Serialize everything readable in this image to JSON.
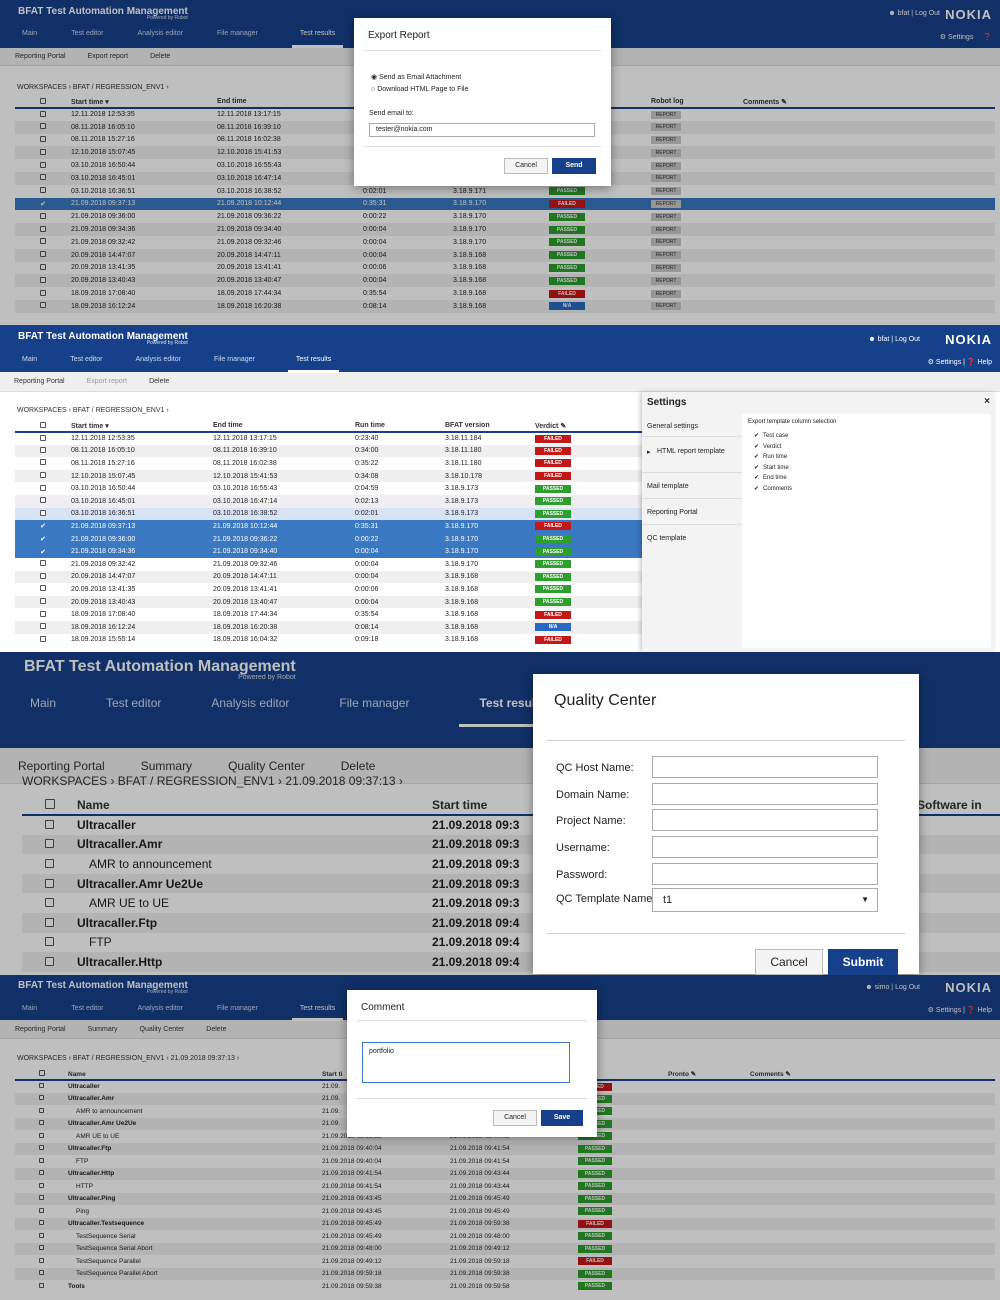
{
  "colors": {
    "brand": "#16418a",
    "passed": "#2e9e2e",
    "failed": "#c31818",
    "na": "#2a68c2",
    "selected": "#3a78c2"
  },
  "p1": {
    "app_title": "BFAT Test Automation Management",
    "powered": "Powered by Robot",
    "user": "bfat",
    "logout": "Log Out",
    "nokia": "NOKIA",
    "settings": "Settings",
    "nav": [
      "Main",
      "Test editor",
      "Analysis editor",
      "File manager",
      "Test results"
    ],
    "sub": [
      "Reporting Portal",
      "Export report",
      "Delete"
    ],
    "crumb": "WORKSPACES › BFAT / REGRESSION_ENV1 ›",
    "cols": [
      "Start time ▾",
      "End time",
      "Robot log",
      "Comments"
    ],
    "rows": [
      {
        "s": "12.11.2018 12:53:35",
        "e": "12.11.2018 13:17:15",
        "r": "",
        "v": "",
        "vc": ""
      },
      {
        "s": "08.11.2018 16:05:10",
        "e": "08.11.2018 16:39:10",
        "r": "",
        "v": "",
        "vc": ""
      },
      {
        "s": "08.11.2018 15:27:16",
        "e": "08.11.2018 16:02:38",
        "r": "",
        "v": "",
        "vc": ""
      },
      {
        "s": "12.10.2018 15:07:45",
        "e": "12.10.2018 15:41:53",
        "r": "",
        "v": "",
        "vc": ""
      },
      {
        "s": "03.10.2018 16:50:44",
        "e": "03.10.2018 16:55:43",
        "r": "",
        "v": "",
        "vc": ""
      },
      {
        "s": "03.10.2018 16:45:01",
        "e": "03.10.2018 16:47:14",
        "r": "",
        "v": "",
        "vc": ""
      },
      {
        "s": "03.10.2018 16:36:51",
        "e": "03.10.2018 16:38:52",
        "r": "0:02:01",
        "b": "3.18.9.171",
        "v": "PASSED",
        "vc": "passed"
      },
      {
        "s": "21.09.2018 09:37:13",
        "e": "21.09.2018 10:12:44",
        "r": "0:35:31",
        "b": "3.18.9.170",
        "v": "FAILED",
        "vc": "failed",
        "sel": true
      },
      {
        "s": "21.09.2018 09:36:00",
        "e": "21.09.2018 09:36:22",
        "r": "0:00:22",
        "b": "3.18.9.170",
        "v": "PASSED",
        "vc": "passed"
      },
      {
        "s": "21.09.2018 09:34:36",
        "e": "21.09.2018 09:34:40",
        "r": "0:00:04",
        "b": "3.18.9.170",
        "v": "PASSED",
        "vc": "passed"
      },
      {
        "s": "21.09.2018 09:32:42",
        "e": "21.09.2018 09:32:46",
        "r": "0:00:04",
        "b": "3.18.9.170",
        "v": "PASSED",
        "vc": "passed"
      },
      {
        "s": "20.09.2018 14:47:07",
        "e": "20.09.2018 14:47:11",
        "r": "0:00:04",
        "b": "3.18.9.168",
        "v": "PASSED",
        "vc": "passed"
      },
      {
        "s": "20.09.2018 13:41:35",
        "e": "20.09.2018 13:41:41",
        "r": "0:00:06",
        "b": "3.18.9.168",
        "v": "PASSED",
        "vc": "passed"
      },
      {
        "s": "20.09.2018 13:40:43",
        "e": "20.09.2018 13:40:47",
        "r": "0:00:04",
        "b": "3.18.9.168",
        "v": "PASSED",
        "vc": "passed"
      },
      {
        "s": "18.09.2018 17:08:40",
        "e": "18.09.2018 17:44:34",
        "r": "0:35:54",
        "b": "3.18.9.168",
        "v": "FAILED",
        "vc": "failed"
      },
      {
        "s": "18.09.2018 16:12:24",
        "e": "18.09.2018 16:20:38",
        "r": "0:08:14",
        "b": "3.18.9.168",
        "v": "N/A",
        "vc": "na"
      }
    ],
    "report": "REPORT",
    "modal": {
      "title": "Export Report",
      "opt1": "Send as Email Attachment",
      "opt2": "Download HTML Page to File",
      "email_label": "Send email to:",
      "email_value": "tester@nokia.com",
      "cancel": "Cancel",
      "send": "Send"
    }
  },
  "p2": {
    "app_title": "BFAT Test Automation Management",
    "powered": "Powered by Robot",
    "user": "bfat",
    "logout": "Log Out",
    "nokia": "NOKIA",
    "settings": "Settings",
    "help": "Help",
    "nav": [
      "Main",
      "Test editor",
      "Analysis editor",
      "File manager",
      "Test results"
    ],
    "sub": [
      "Reporting Portal",
      "Export report",
      "Delete"
    ],
    "crumb": "WORKSPACES › BFAT / REGRESSION_ENV1 ›",
    "cols": [
      "Start time ▾",
      "End time",
      "Run time",
      "BFAT version",
      "Verdict"
    ],
    "rows": [
      {
        "s": "12.11.2018 12:53:35",
        "e": "12.11.2018 13:17:15",
        "r": "0:23:40",
        "b": "3.18.11.184",
        "v": "FAILED",
        "vc": "failed"
      },
      {
        "s": "08.11.2018 16:05:10",
        "e": "08.11.2018 16:39:10",
        "r": "0:34:00",
        "b": "3.18.11.180",
        "v": "FAILED",
        "vc": "failed"
      },
      {
        "s": "08.11.2018 15:27:16",
        "e": "08.11.2018 16:02:38",
        "r": "0:35:22",
        "b": "3.18.11.180",
        "v": "FAILED",
        "vc": "failed"
      },
      {
        "s": "12.10.2018 15:07:45",
        "e": "12.10.2018 15:41:53",
        "r": "0:34:08",
        "b": "3.18.10.178",
        "v": "FAILED",
        "vc": "failed"
      },
      {
        "s": "03.10.2018 16:50:44",
        "e": "03.10.2018 16:55:43",
        "r": "0:04:59",
        "b": "3.18.9.173",
        "v": "PASSED",
        "vc": "passed"
      },
      {
        "s": "03.10.2018 16:45:01",
        "e": "03.10.2018 16:47:14",
        "r": "0:02:13",
        "b": "3.18.9.173",
        "v": "PASSED",
        "vc": "passed"
      },
      {
        "s": "03.10.2018 16:36:51",
        "e": "03.10.2018 16:38:52",
        "r": "0:02:01",
        "b": "3.18.9.173",
        "v": "PASSED",
        "vc": "passed",
        "lsel": true
      },
      {
        "s": "21.09.2018 09:37:13",
        "e": "21.09.2018 10:12:44",
        "r": "0:35:31",
        "b": "3.18.9.170",
        "v": "FAILED",
        "vc": "failed",
        "sel": true
      },
      {
        "s": "21.09.2018 09:36:00",
        "e": "21.09.2018 09:36:22",
        "r": "0:00:22",
        "b": "3.18.9.170",
        "v": "PASSED",
        "vc": "passed",
        "sel": true
      },
      {
        "s": "21.09.2018 09:34:36",
        "e": "21.09.2018 09:34:40",
        "r": "0:00:04",
        "b": "3.18.9.170",
        "v": "PASSED",
        "vc": "passed",
        "sel": true
      },
      {
        "s": "21.09.2018 09:32:42",
        "e": "21.09.2018 09:32:46",
        "r": "0:00:04",
        "b": "3.18.9.170",
        "v": "PASSED",
        "vc": "passed"
      },
      {
        "s": "20.09.2018 14:47:07",
        "e": "20.09.2018 14:47:11",
        "r": "0:00:04",
        "b": "3.18.9.168",
        "v": "PASSED",
        "vc": "passed"
      },
      {
        "s": "20.09.2018 13:41:35",
        "e": "20.09.2018 13:41:41",
        "r": "0:00:06",
        "b": "3.18.9.168",
        "v": "PASSED",
        "vc": "passed"
      },
      {
        "s": "20.09.2018 13:40:43",
        "e": "20.09.2018 13:40:47",
        "r": "0:00:04",
        "b": "3.18.9.168",
        "v": "PASSED",
        "vc": "passed"
      },
      {
        "s": "18.09.2018 17:08:40",
        "e": "18.09.2018 17:44:34",
        "r": "0:35:54",
        "b": "3.18.9.168",
        "v": "FAILED",
        "vc": "failed"
      },
      {
        "s": "18.09.2018 16:12:24",
        "e": "18.09.2018 16:20:38",
        "r": "0:08:14",
        "b": "3.18.9.168",
        "v": "N/A",
        "vc": "na"
      },
      {
        "s": "18.09.2018 15:55:14",
        "e": "18.09.2018 16:04:32",
        "r": "0:09:18",
        "b": "3.18.9.168",
        "v": "FAILED",
        "vc": "failed"
      }
    ],
    "settings_panel": {
      "title": "Settings",
      "close": "×",
      "menu": [
        "General settings",
        "HTML report template",
        "Mail template",
        "Reporting Portal",
        "QC template"
      ],
      "section_title": "Export template column selection",
      "checks": [
        "Test case",
        "Verdict",
        "Run time",
        "Start time",
        "End time",
        "Comments"
      ]
    }
  },
  "p3": {
    "app_title": "BFAT Test Automation Management",
    "powered": "Powered by Robot",
    "nav": [
      "Main",
      "Test editor",
      "Analysis editor",
      "File manager",
      "Test results"
    ],
    "sub": [
      "Reporting Portal",
      "Summary",
      "Quality Center",
      "Delete"
    ],
    "crumb": "WORKSPACES › BFAT / REGRESSION_ENV1 › 21.09.2018 09:37:13 ›",
    "cols": [
      "Name",
      "Start time",
      "Software in"
    ],
    "rows": [
      {
        "n": "Ultracaller",
        "t": "21.09.2018 09:3",
        "bold": true,
        "indent": 0
      },
      {
        "n": "Ultracaller.Amr",
        "t": "21.09.2018 09:3",
        "bold": true,
        "indent": 0
      },
      {
        "n": "AMR to announcement",
        "t": "21.09.2018 09:3",
        "bold": false,
        "indent": 1
      },
      {
        "n": "Ultracaller.Amr Ue2Ue",
        "t": "21.09.2018 09:3",
        "bold": true,
        "indent": 0
      },
      {
        "n": "AMR UE to UE",
        "t": "21.09.2018 09:3",
        "bold": false,
        "indent": 1
      },
      {
        "n": "Ultracaller.Ftp",
        "t": "21.09.2018 09:4",
        "bold": true,
        "indent": 0
      },
      {
        "n": "FTP",
        "t": "21.09.2018 09:4",
        "bold": false,
        "indent": 1
      },
      {
        "n": "Ultracaller.Http",
        "t": "21.09.2018 09:4",
        "bold": true,
        "indent": 0
      }
    ],
    "modal": {
      "title": "Quality Center",
      "fields": [
        {
          "label": "QC Host Name:",
          "value": ""
        },
        {
          "label": "Domain Name:",
          "value": ""
        },
        {
          "label": "Project Name:",
          "value": ""
        },
        {
          "label": "Username:",
          "value": ""
        },
        {
          "label": "Password:",
          "value": ""
        }
      ],
      "template_label": "QC Template Name:",
      "template_value": "t1",
      "cancel": "Cancel",
      "submit": "Submit"
    }
  },
  "p4": {
    "app_title": "BFAT Test Automation Management",
    "powered": "Powered by Robot",
    "user": "simo",
    "logout": "Log Out",
    "nokia": "NOKIA",
    "settings": "Settings",
    "help": "Help",
    "nav": [
      "Main",
      "Test editor",
      "Analysis editor",
      "File manager",
      "Test results"
    ],
    "sub": [
      "Reporting Portal",
      "Summary",
      "Quality Center",
      "Delete"
    ],
    "crumb": "WORKSPACES › BFAT / REGRESSION_ENV1 › 21.09.2018 09:37:13 ›",
    "cols": [
      "Name",
      "Start ti",
      "Pronto",
      "Comments"
    ],
    "rows": [
      {
        "n": "Ultracaller",
        "s": "21.09.",
        "e": "",
        "v": "FAILED",
        "vc": "failed",
        "bold": true,
        "indent": 0
      },
      {
        "n": "Ultracaller.Amr",
        "s": "21.09.",
        "e": "",
        "v": "PASSED",
        "vc": "passed",
        "bold": true,
        "indent": 0
      },
      {
        "n": "AMR to announcement",
        "s": "21.09.",
        "e": "",
        "v": "PASSED",
        "vc": "passed",
        "bold": false,
        "indent": 1
      },
      {
        "n": "Ultracaller.Amr Ue2Ue",
        "s": "21.09.",
        "e": "",
        "v": "PASSED",
        "vc": "passed",
        "bold": true,
        "indent": 0
      },
      {
        "n": "AMR UE to UE",
        "s": "21.09.2018 09:39:36",
        "e": "21.09.2018 09:40:09",
        "v": "PASSED",
        "vc": "passed",
        "bold": false,
        "indent": 1
      },
      {
        "n": "Ultracaller.Ftp",
        "s": "21.09.2018 09:40:04",
        "e": "21.09.2018 09:41:54",
        "v": "PASSED",
        "vc": "passed",
        "bold": true,
        "indent": 0
      },
      {
        "n": "FTP",
        "s": "21.09.2018 09:40:04",
        "e": "21.09.2018 09:41:54",
        "v": "PASSED",
        "vc": "passed",
        "bold": false,
        "indent": 1
      },
      {
        "n": "Ultracaller.Http",
        "s": "21.09.2018 09:41:54",
        "e": "21.09.2018 09:43:44",
        "v": "PASSED",
        "vc": "passed",
        "bold": true,
        "indent": 0
      },
      {
        "n": "HTTP",
        "s": "21.09.2018 09:41:54",
        "e": "21.09.2018 09:43:44",
        "v": "PASSED",
        "vc": "passed",
        "bold": false,
        "indent": 1
      },
      {
        "n": "Ultracaller.Ping",
        "s": "21.09.2018 09:43:45",
        "e": "21.09.2018 09:45:49",
        "v": "PASSED",
        "vc": "passed",
        "bold": true,
        "indent": 0
      },
      {
        "n": "Ping",
        "s": "21.09.2018 09:43:45",
        "e": "21.09.2018 09:45:49",
        "v": "PASSED",
        "vc": "passed",
        "bold": false,
        "indent": 1
      },
      {
        "n": "Ultracaller.Testsequence",
        "s": "21.09.2018 09:45:49",
        "e": "21.09.2018 09:59:38",
        "v": "FAILED",
        "vc": "failed",
        "bold": true,
        "indent": 0
      },
      {
        "n": "TestSequence Serial",
        "s": "21.09.2018 09:45:49",
        "e": "21.09.2018 09:48:00",
        "v": "PASSED",
        "vc": "passed",
        "bold": false,
        "indent": 1
      },
      {
        "n": "TestSequence Serial Abort",
        "s": "21.09.2018 09:48:00",
        "e": "21.09.2018 09:49:12",
        "v": "PASSED",
        "vc": "passed",
        "bold": false,
        "indent": 1
      },
      {
        "n": "TestSequence Parallel",
        "s": "21.09.2018 09:49:12",
        "e": "21.09.2018 09:59:18",
        "v": "FAILED",
        "vc": "failed",
        "bold": false,
        "indent": 1
      },
      {
        "n": "TestSequence Parallel Abort",
        "s": "21.09.2018 09:59:18",
        "e": "21.09.2018 09:59:38",
        "v": "PASSED",
        "vc": "passed",
        "bold": false,
        "indent": 1
      },
      {
        "n": "Tools",
        "s": "21.09.2018 09:59:38",
        "e": "21.09.2018 09:59:58",
        "v": "PASSED",
        "vc": "passed",
        "bold": true,
        "indent": 0
      }
    ],
    "modal": {
      "title": "Comment",
      "value": "portfolio",
      "cancel": "Cancel",
      "save": "Save"
    }
  }
}
